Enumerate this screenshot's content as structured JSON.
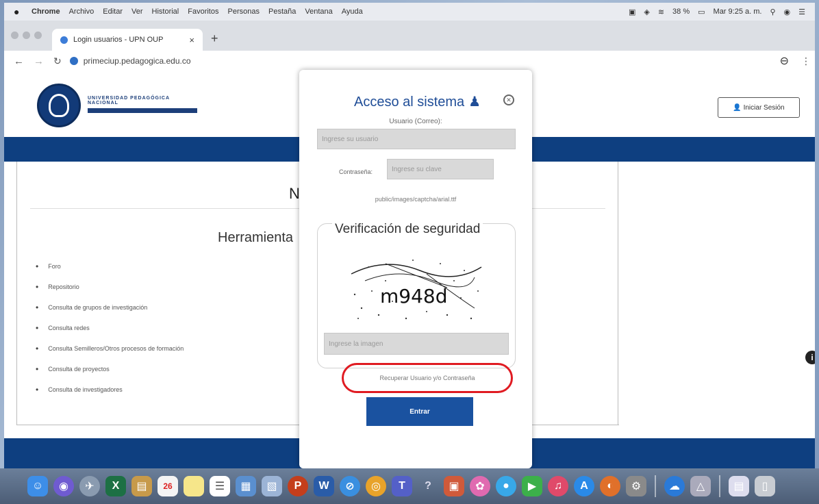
{
  "menubar": {
    "app": "Chrome",
    "items": [
      "Archivo",
      "Editar",
      "Ver",
      "Historial",
      "Favoritos",
      "Personas",
      "Pestaña",
      "Ventana",
      "Ayuda"
    ],
    "battery": "38 %",
    "clock": "Mar 9:25 a. m."
  },
  "browser": {
    "tab_title": "Login usuarios - UPN OUP",
    "close_glyph": "×",
    "newtab_glyph": "+",
    "url": "primeciup.pedagogica.edu.co"
  },
  "site": {
    "logo_line1": "UNIVERSIDAD PEDAGÓGICA",
    "logo_line2": "NACIONAL",
    "login_button": "Iniciar Sesión",
    "heading_fragment": "N",
    "tools_title": "Herramienta",
    "tools": [
      "Foro",
      "Repositorio",
      "Consulta de grupos de investigación",
      "Consulta redes",
      "Consulta Semilleros/Otros procesos de formación",
      "Consulta de proyectos",
      "Consulta de investigadores"
    ]
  },
  "modal": {
    "title": "Acceso al sistema",
    "user_label": "Usuario (Correo):",
    "user_placeholder": "Ingrese su usuario",
    "password_label": "Contraseña:",
    "password_placeholder": "Ingrese su clave",
    "captcha_path": "public/images/captcha/arial.ttf",
    "verify_title": "Verificación de seguridad",
    "captcha_text": "m948d",
    "captcha_placeholder": "Ingrese la imagen",
    "recover_link": "Recuperar Usuario y/o Contraseña",
    "enter_button": "Entrar"
  },
  "colors": {
    "brand_blue": "#0e3f80",
    "button_blue": "#1a52a0",
    "highlight_red": "#e01b22"
  },
  "dock": {
    "icons": [
      "finder-icon",
      "siri-icon",
      "launchpad-icon",
      "excel-icon",
      "notes-icon",
      "calendar-icon",
      "stickies-icon",
      "reminders-icon",
      "preview-icon",
      "photos-icon",
      "powerpoint-icon",
      "word-icon",
      "safari-icon",
      "chrome-icon",
      "teams-icon",
      "help-icon",
      "photobooth-icon",
      "itunes-icon",
      "messages-icon",
      "facetime-icon",
      "music-icon",
      "appstore-icon",
      "firefox-icon",
      "settings-icon",
      "onedrive-icon",
      "drive-icon",
      "documents-icon",
      "trash-icon"
    ],
    "calendar_day": "26"
  }
}
